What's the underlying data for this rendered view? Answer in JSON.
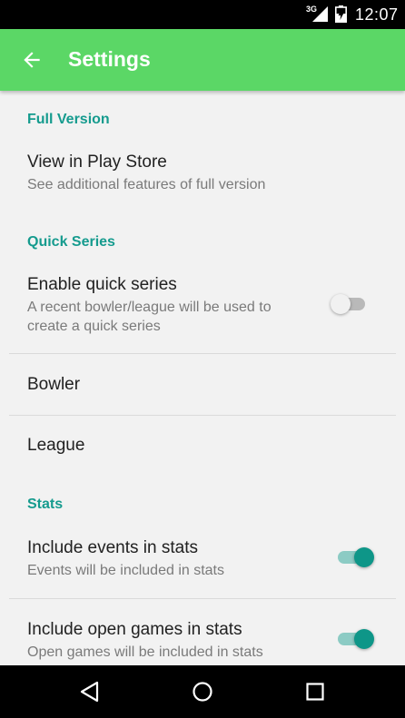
{
  "status_bar": {
    "network": "3G",
    "time": "12:07",
    "icons": [
      "signal-icon",
      "battery-charging-icon"
    ]
  },
  "app_bar": {
    "title": "Settings",
    "back_icon": "arrow-back-icon"
  },
  "categories": {
    "full_version": "Full Version",
    "quick_series": "Quick Series",
    "stats": "Stats"
  },
  "prefs": {
    "view_play_store": {
      "title": "View in Play Store",
      "summary": "See additional features of full version"
    },
    "quick_series": {
      "title": "Enable quick series",
      "summary": "A recent bowler/league will be used to create a quick series",
      "enabled": false
    },
    "bowler": {
      "title": "Bowler"
    },
    "league": {
      "title": "League"
    },
    "include_events": {
      "title": "Include events in stats",
      "summary": "Events will be included in stats",
      "enabled": true
    },
    "include_open": {
      "title": "Include open games in stats",
      "summary": "Open games will be included in stats",
      "enabled": true
    }
  },
  "nav_bar": {
    "icons": [
      "back-triangle-icon",
      "home-circle-icon",
      "recents-square-icon"
    ]
  },
  "colors": {
    "primary": "#5bd766",
    "accent": "#0e9688",
    "category": "#159b8e"
  }
}
